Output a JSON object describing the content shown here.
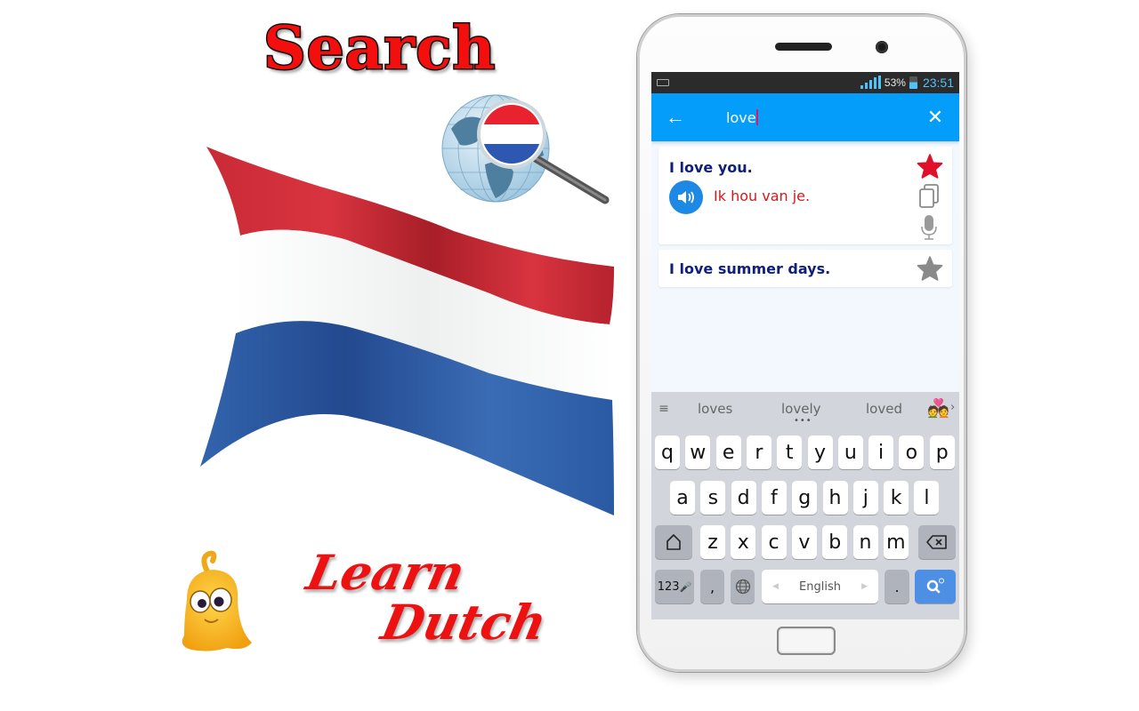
{
  "promo": {
    "title": "Search",
    "tagline_line1": "Learn",
    "tagline_line2": "Dutch",
    "flag_colors": {
      "red": "#d22f3c",
      "white": "#ffffff",
      "blue": "#2b5aa0"
    }
  },
  "status_bar": {
    "battery": "53%",
    "time": "23:51"
  },
  "search_bar": {
    "query": "love",
    "back_icon": "arrow-left-icon",
    "clear_icon": "close-icon"
  },
  "results": [
    {
      "english": "I love you.",
      "dutch": "Ik hou van je.",
      "favorited": true,
      "expanded": true
    },
    {
      "english": "I love summer days.",
      "favorited": false,
      "expanded": false
    }
  ],
  "keyboard": {
    "suggestions": [
      "loves",
      "lovely",
      "loved"
    ],
    "row1": [
      "q",
      "w",
      "e",
      "r",
      "t",
      "y",
      "u",
      "i",
      "o",
      "p"
    ],
    "row2": [
      "a",
      "s",
      "d",
      "f",
      "g",
      "h",
      "j",
      "k",
      "l"
    ],
    "row3": [
      "z",
      "x",
      "c",
      "v",
      "b",
      "n",
      "m"
    ],
    "numbers_key": "123",
    "comma_key": ",",
    "period_key": ".",
    "space_label": "English"
  },
  "colors": {
    "app_bar": "#049dfa",
    "english_text": "#10207a",
    "dutch_text": "#d21a1a",
    "star_active": "#e0102a",
    "star_inactive": "#8a8a8a"
  }
}
